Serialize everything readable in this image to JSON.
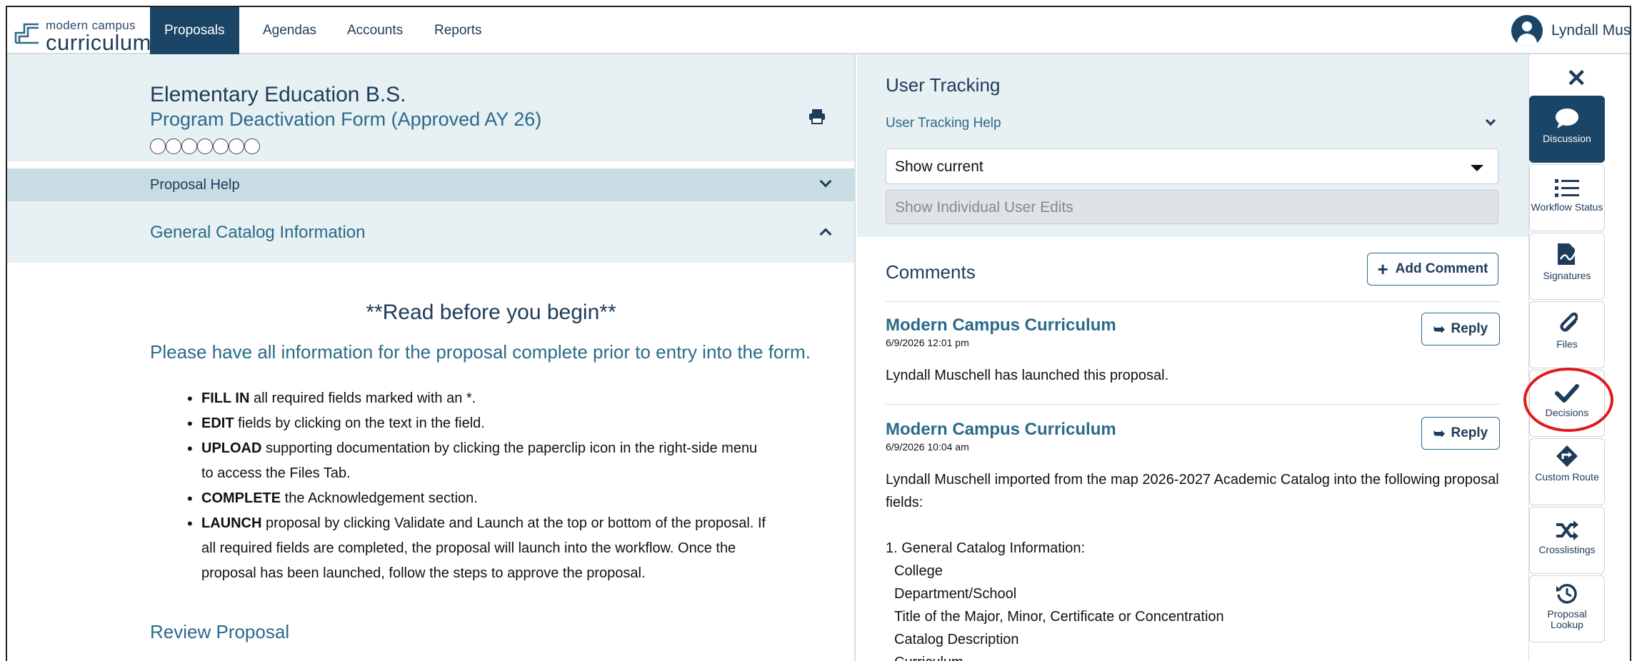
{
  "logo": {
    "small": "modern campus",
    "big": "curriculum",
    "tm": "™"
  },
  "nav": {
    "tabs": [
      {
        "label": "Proposals"
      },
      {
        "label": "Agendas"
      },
      {
        "label": "Accounts"
      },
      {
        "label": "Reports"
      }
    ],
    "user_name": "Lyndall Musc"
  },
  "proposal": {
    "title": "Elementary Education B.S.",
    "subtitle": "Program Deactivation Form (Approved AY 26)",
    "help_label": "Proposal Help",
    "section_label": "General Catalog Information",
    "read_heading": "**Read before you begin**",
    "please_text": "Please have all information for the proposal complete prior to entry into the form.",
    "bullets": [
      {
        "bold": "FILL IN",
        "rest": " all required fields marked with an *."
      },
      {
        "bold": "EDIT",
        "rest": " fields by clicking on the text in the field."
      },
      {
        "bold": "UPLOAD",
        "rest": " supporting documentation by clicking the paperclip icon in the right-side menu to access the Files Tab."
      },
      {
        "bold": "COMPLETE",
        "rest": " the Acknowledgement section."
      },
      {
        "bold": "LAUNCH",
        "rest": " proposal by clicking Validate and Launch at the top or bottom of the proposal.  If all required fields are completed, the proposal will launch into the workflow. Once the proposal has been launched, follow the steps to approve the proposal."
      }
    ],
    "review_label": "Review Proposal"
  },
  "user_tracking": {
    "title": "User Tracking",
    "help_label": "User Tracking Help",
    "select_value": "Show current",
    "disabled_placeholder": "Show Individual User Edits"
  },
  "comments": {
    "title": "Comments",
    "add_label": "Add Comment",
    "reply_label": "Reply",
    "items": [
      {
        "author": "Modern Campus Curriculum",
        "date": "6/9/2026 12:01 pm",
        "text": "Lyndall Muschell has launched this proposal."
      },
      {
        "author": "Modern Campus Curriculum",
        "date": "6/9/2026 10:04 am",
        "text": "Lyndall Muschell imported from the map 2026-2027 Academic Catalog into the following proposal fields:",
        "list_head": "1. General Catalog Information:",
        "list": [
          "College",
          "Department/School",
          "Title of the Major, Minor, Certificate or Concentration",
          "Catalog Description",
          "Curriculum"
        ]
      }
    ]
  },
  "rail": {
    "close_glyph": "✕",
    "items": [
      {
        "label": "Discussion",
        "icon": "speech-bubble-icon"
      },
      {
        "label": "Workflow Status",
        "icon": "list-icon"
      },
      {
        "label": "Signatures",
        "icon": "signature-icon"
      },
      {
        "label": "Files",
        "icon": "paperclip-icon"
      },
      {
        "label": "Decisions",
        "icon": "checkmark-icon"
      },
      {
        "label": "Custom Route",
        "icon": "route-diamond-icon"
      },
      {
        "label": "Crosslistings",
        "icon": "shuffle-icon"
      },
      {
        "label": "Proposal Lookup",
        "icon": "history-icon"
      }
    ]
  },
  "colors": {
    "primary": "#1b4566",
    "accent": "#2a6a8a",
    "panel": "#e7f0f3",
    "highlight": "#e01a1a"
  }
}
